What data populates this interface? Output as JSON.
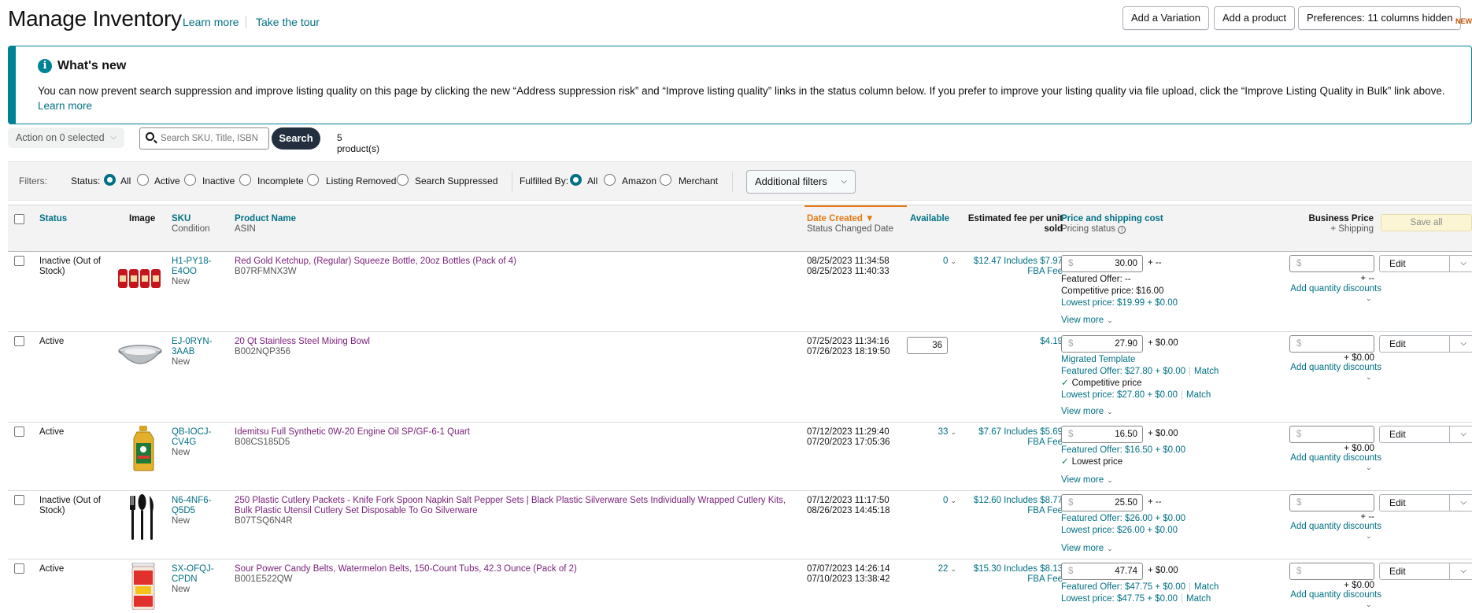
{
  "header": {
    "title": "Manage Inventory",
    "learn_more": "Learn more",
    "take_tour": "Take the tour",
    "add_variation": "Add a Variation",
    "add_product": "Add a product",
    "preferences": "Preferences: 11 columns hidden",
    "new_badge": "NEW"
  },
  "whats_new": {
    "title": "What's new",
    "body": "You can now prevent search suppression and improve listing quality on this page by clicking the new “Address suppression risk” and “Improve listing quality” links in the status column below. If you prefer to improve your listing quality via file upload, click the “Improve Listing Quality in Bulk” link above.",
    "learn_more": "Learn more"
  },
  "actions": {
    "action_select": "Action on 0 selected",
    "search_placeholder": "Search SKU, Title, ISBN",
    "search_button": "Search",
    "product_count": "5 product(s)"
  },
  "filters": {
    "label": "Filters:",
    "status_label": "Status:",
    "status_options": [
      "All",
      "Active",
      "Inactive",
      "Incomplete",
      "Listing Removed",
      "Search Suppressed"
    ],
    "status_selected": "All",
    "fulfilled_label": "Fulfilled By:",
    "fulfilled_options": [
      "All",
      "Amazon",
      "Merchant"
    ],
    "fulfilled_selected": "All",
    "additional": "Additional filters"
  },
  "columns": {
    "status": "Status",
    "image": "Image",
    "sku": "SKU",
    "condition": "Condition",
    "product_name": "Product Name",
    "asin": "ASIN",
    "date_created": "Date Created",
    "status_changed": "Status Changed Date",
    "available": "Available",
    "fee": "Estimated fee per unit sold",
    "price": "Price and shipping cost",
    "pricing_status": "Pricing status",
    "business_price": "Business Price",
    "shipping": "+ Shipping",
    "save_all": "Save all"
  },
  "rows": [
    {
      "status": "Inactive (Out of Stock)",
      "sku": "H1-PY18-E4OO",
      "condition": "New",
      "name": "Red Gold Ketchup, (Regular) Squeeze Bottle, 20oz Bottles (Pack of 4)",
      "asin": "B07RFMNX3W",
      "created": "08/25/2023 11:34:58",
      "changed": "08/25/2023 11:40:33",
      "available": "0",
      "fee": "$12.47 Includes $7.97 FBA Fee",
      "price": "30.00",
      "ship": "+ --",
      "info1": "Featured Offer: --",
      "info2": "Competitive price: $16.00",
      "info3": "Lowest price: $19.99 + $0.00",
      "view_more": "View more",
      "bp_ship": "+ --",
      "qty": "Add quantity discounts",
      "edit": "Edit"
    },
    {
      "status": "Active",
      "sku": "EJ-0RYN-3AAB",
      "condition": "New",
      "name": "20 Qt Stainless Steel Mixing Bowl",
      "asin": "B002NQP356",
      "created": "07/25/2023 11:34:16",
      "changed": "07/26/2023 18:19:50",
      "available": "36",
      "fee": "$4.19",
      "price": "27.90",
      "ship": "+ $0.00",
      "info1": "Migrated Template",
      "info2": "Featured Offer: $27.80 + $0.00",
      "info2_match": "Match",
      "info3": "Competitive price",
      "info4": "Lowest price: $27.80 + $0.00",
      "info4_match": "Match",
      "view_more": "View more",
      "bp_ship": "+ $0.00",
      "qty": "Add quantity discounts",
      "edit": "Edit"
    },
    {
      "status": "Active",
      "sku": "QB-IOCJ-CV4G",
      "condition": "New",
      "name": "Idemitsu Full Synthetic 0W-20 Engine Oil SP/GF-6-1 Quart",
      "asin": "B08CS185D5",
      "created": "07/12/2023 11:29:40",
      "changed": "07/20/2023 17:05:36",
      "available": "33",
      "fee": "$7.67 Includes $5.69 FBA Fee",
      "price": "16.50",
      "ship": "+ $0.00",
      "info1": "Featured Offer: $16.50 + $0.00",
      "info2": "Lowest price",
      "view_more": "View more",
      "bp_ship": "+ $0.00",
      "qty": "Add quantity discounts",
      "edit": "Edit"
    },
    {
      "status": "Inactive (Out of Stock)",
      "sku": "N6-4NF6-Q5D5",
      "condition": "New",
      "name": "250 Plastic Cutlery Packets - Knife Fork Spoon Napkin Salt Pepper Sets | Black Plastic Silverware Sets Individually Wrapped Cutlery Kits, Bulk Plastic Utensil Cutlery Set Disposable To Go Silverware",
      "asin": "B07TSQ6N4R",
      "created": "07/12/2023 11:17:50",
      "changed": "08/26/2023 14:45:18",
      "available": "0",
      "fee": "$12.60 Includes $8.77 FBA Fee",
      "price": "25.50",
      "ship": "+ --",
      "info1": "Featured Offer: $26.00 + $0.00",
      "info2": "Lowest price: $26.00 + $0.00",
      "view_more": "View more",
      "bp_ship": "+ --",
      "qty": "Add quantity discounts",
      "edit": "Edit"
    },
    {
      "status": "Active",
      "sku": "SX-OFQJ-CPDN",
      "condition": "New",
      "name": "Sour Power Candy Belts, Watermelon Belts, 150-Count Tubs, 42.3 Ounce (Pack of 2)",
      "asin": "B001E522QW",
      "created": "07/07/2023 14:26:14",
      "changed": "07/10/2023 13:38:42",
      "available": "22",
      "fee": "$15.30 Includes $8.13 FBA Fee",
      "price": "47.74",
      "ship": "+ $0.00",
      "info1": "Featured Offer: $47.75 + $0.00",
      "info1_match": "Match",
      "info2": "Lowest price: $47.75 + $0.00",
      "info2_match": "Match",
      "bp_ship": "+ $0.00",
      "qty": "Add quantity discounts",
      "edit": "Edit"
    }
  ],
  "price_placeholder": "$",
  "colors": {
    "link": "#007185",
    "accent": "#008296",
    "product": "#7a1f7a",
    "sort": "#e47911",
    "search_button": "#232f3e"
  }
}
